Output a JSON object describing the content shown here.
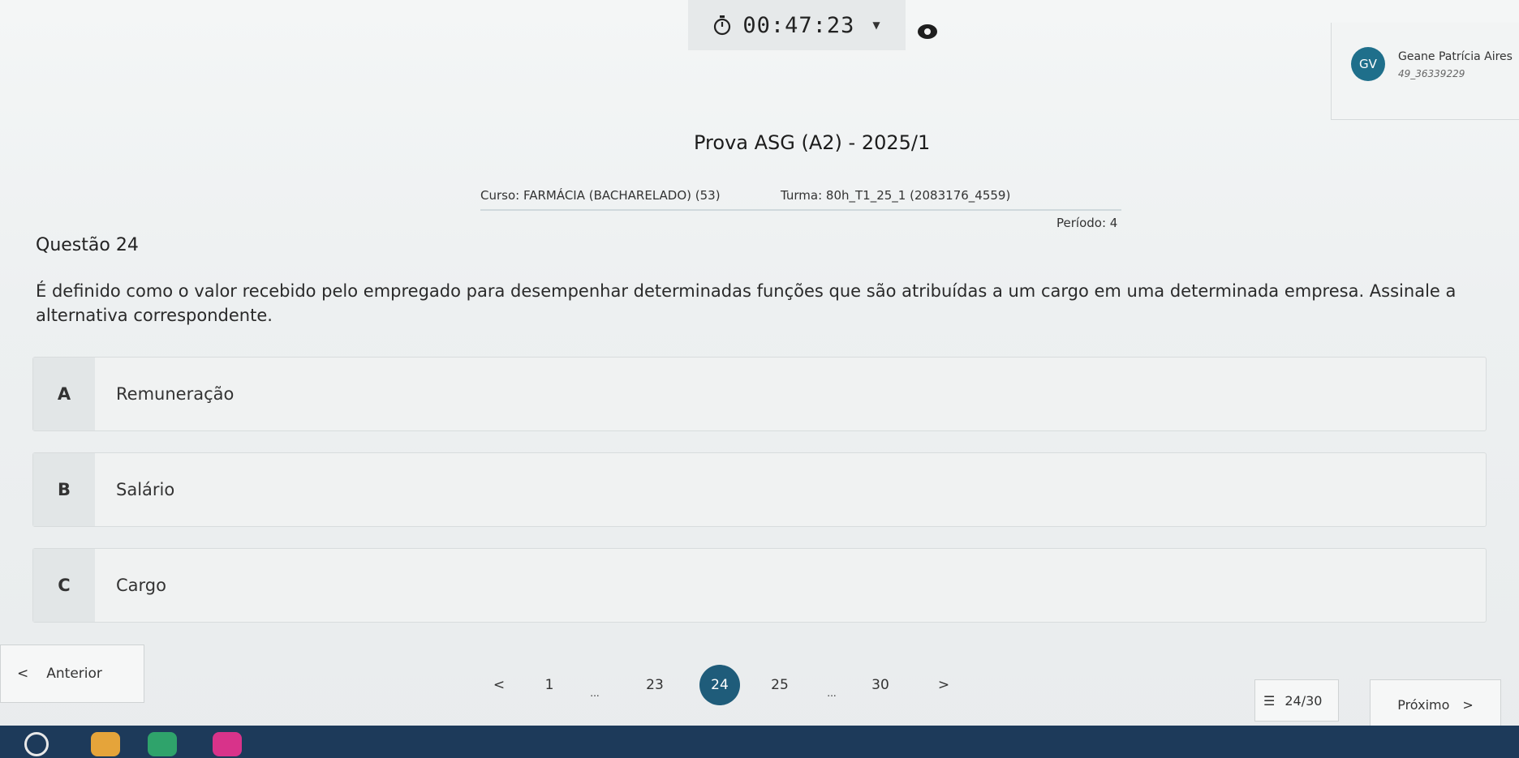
{
  "header": {
    "timer": "00:47:23",
    "user_initials": "GV",
    "user_name": "Geane Patrícia Aires",
    "user_id": "49_36339229"
  },
  "exam": {
    "title": "Prova ASG (A2) - 2025/1",
    "curso": "Curso: FARMÁCIA (BACHARELADO) (53)",
    "turma": "Turma: 80h_T1_25_1 (2083176_4559)",
    "periodo": "Período: 4"
  },
  "question": {
    "label": "Questão 24",
    "text": "É definido como o valor recebido pelo empregado para desempenhar determinadas funções que são atribuídas a um cargo em uma determinada empresa. Assinale a alternativa correspondente.",
    "options": [
      {
        "letter": "A",
        "text": "Remuneração"
      },
      {
        "letter": "B",
        "text": "Salário"
      },
      {
        "letter": "C",
        "text": "Cargo"
      }
    ]
  },
  "nav": {
    "prev_label": "Anterior",
    "next_label": "Próximo",
    "pages": [
      "1",
      "...",
      "23",
      "24",
      "25",
      "...",
      "30"
    ],
    "current_page": "24",
    "count": "24/30"
  },
  "colors": {
    "accent": "#1f5c7a",
    "avatar": "#1f6f8b"
  }
}
